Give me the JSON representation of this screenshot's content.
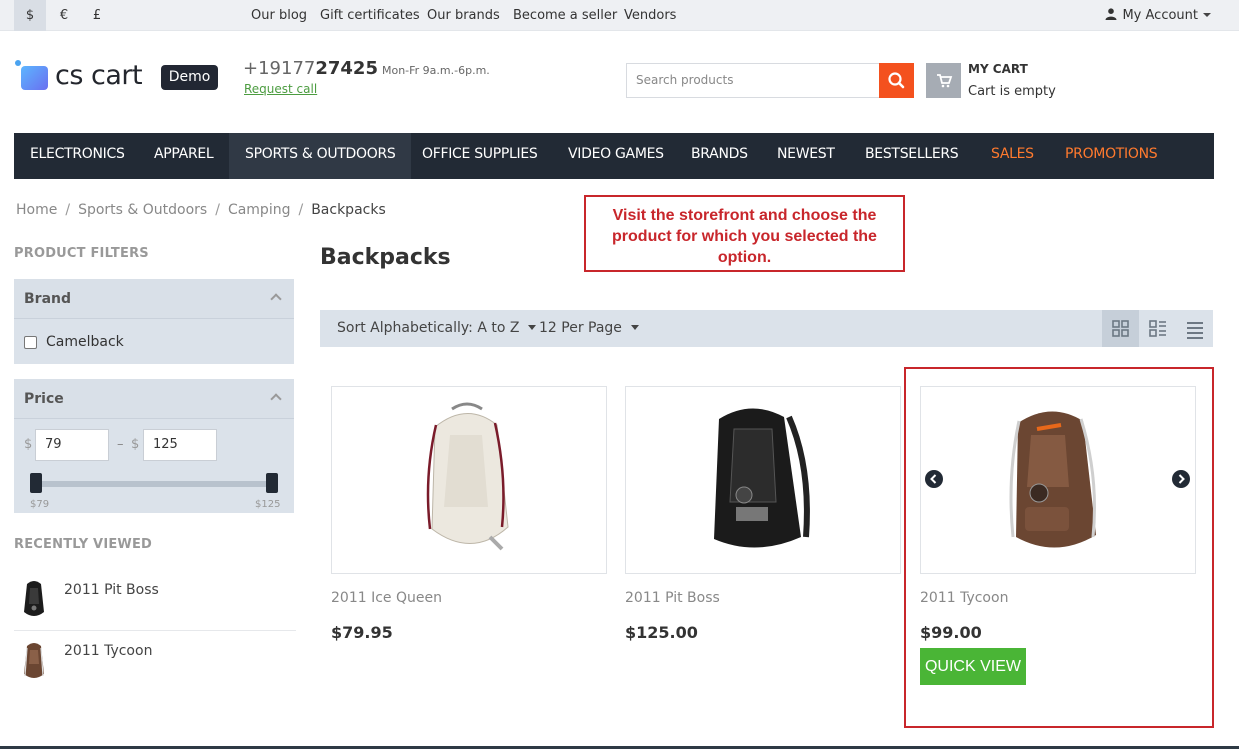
{
  "topbar": {
    "currencies": [
      "$",
      "€",
      "£"
    ],
    "links": [
      "Our blog",
      "Gift certificates",
      "Our brands",
      "Become a seller",
      "Vendors"
    ],
    "account": "My Account"
  },
  "header": {
    "logo": "cs cart",
    "demo_badge": "Demo",
    "phone_prefix": "+19177",
    "phone_bold": "27425",
    "hours": "Mon-Fr 9a.m.-6p.m.",
    "request_call": "Request call",
    "search_placeholder": "Search products",
    "cart_title": "MY CART",
    "cart_status": "Cart is empty"
  },
  "menu": [
    "ELECTRONICS",
    "APPAREL",
    "SPORTS & OUTDOORS",
    "OFFICE SUPPLIES",
    "VIDEO GAMES",
    "BRANDS",
    "NEWEST",
    "BESTSELLERS",
    "SALES",
    "PROMOTIONS"
  ],
  "colors": {
    "accent": "#f4511e",
    "menu_bg": "#222a35",
    "promo": "#ff7a2e",
    "quick_view": "#4ab536",
    "callout": "#c8262b"
  },
  "breadcrumbs": [
    "Home",
    "Sports & Outdoors",
    "Camping",
    "Backpacks"
  ],
  "callout": "Visit the storefront and choose the product for which you selected the option.",
  "filters": {
    "heading": "PRODUCT FILTERS",
    "brand_title": "Brand",
    "brand_option": "Camelback",
    "price_title": "Price",
    "currency": "$",
    "min": "79",
    "max": "125",
    "dash": "–",
    "min_label": "$79",
    "max_label": "$125"
  },
  "recently_viewed": {
    "heading": "RECENTLY VIEWED",
    "items": [
      "2011 Pit Boss",
      "2011 Tycoon"
    ]
  },
  "page_title": "Backpacks",
  "sort": {
    "order": "Sort Alphabetically: A to Z",
    "per_page": "12 Per Page"
  },
  "view_icons": [
    "grid-view-icon",
    "list-view-icon",
    "compact-list-icon"
  ],
  "products": [
    {
      "name": "2011 Ice Queen",
      "price": "$79.95"
    },
    {
      "name": "2011 Pit Boss",
      "price": "$125.00"
    },
    {
      "name": "2011 Tycoon",
      "price": "$99.00"
    }
  ],
  "quick_view": "QUICK VIEW"
}
